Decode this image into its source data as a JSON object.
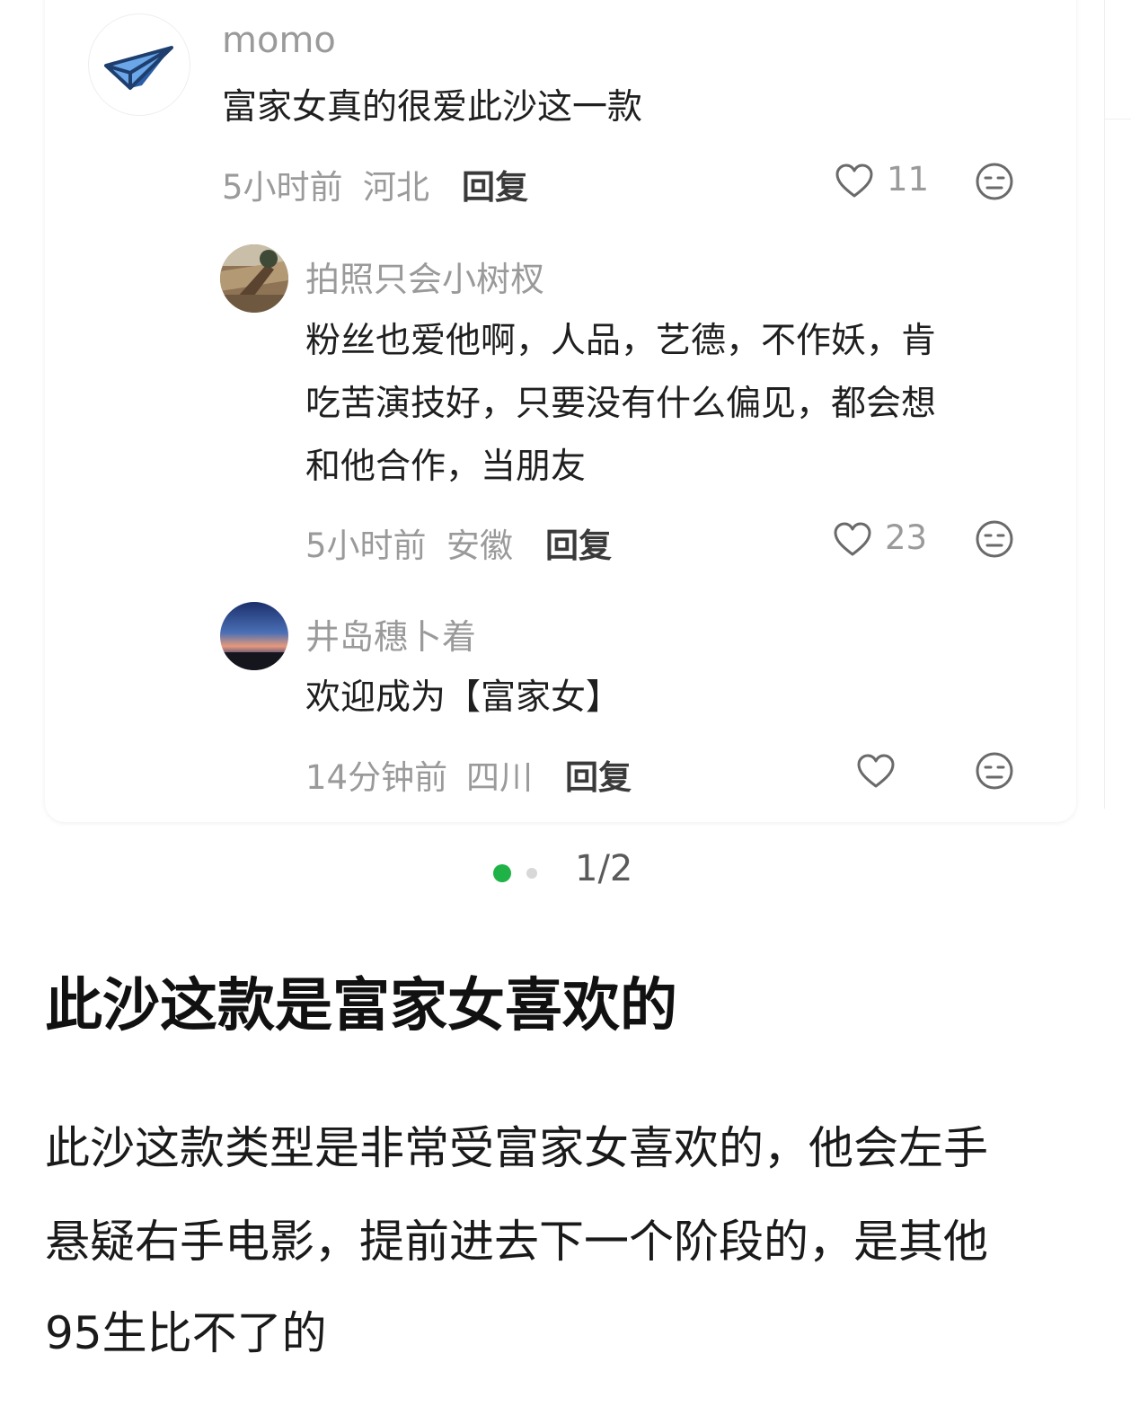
{
  "comments": [
    {
      "username": "momo",
      "avatar_icon": "paper-plane-icon",
      "text_lines": [
        "富家女真的很爱此沙这一款"
      ],
      "time": "5小时前",
      "location": "河北",
      "reply_label": "回复",
      "likes": "11",
      "replies": [
        {
          "username": "拍照只会小树杈",
          "avatar_icon": "photo-avatar",
          "text_lines": [
            "粉丝也爱他啊，人品，艺德，不作妖，肯",
            "吃苦演技好，只要没有什么偏见，都会想",
            "和他合作，当朋友"
          ],
          "time": "5小时前",
          "location": "安徽",
          "reply_label": "回复",
          "likes": "23"
        },
        {
          "username": "井岛穗卜着",
          "avatar_icon": "sunset-avatar",
          "text_lines": [
            "欢迎成为【富家女】"
          ],
          "time": "14分钟前",
          "location": "四川",
          "reply_label": "回复",
          "likes": ""
        }
      ]
    }
  ],
  "pager": {
    "text": "1/2",
    "active_color": "#1fb247"
  },
  "article": {
    "headline": "此沙这款是富家女喜欢的",
    "body_lines": [
      "此沙这款类型是非常受富家女喜欢的，他会左手",
      "悬疑右手电影，提前进去下一个阶段的，是其他",
      "95生比不了的"
    ]
  }
}
